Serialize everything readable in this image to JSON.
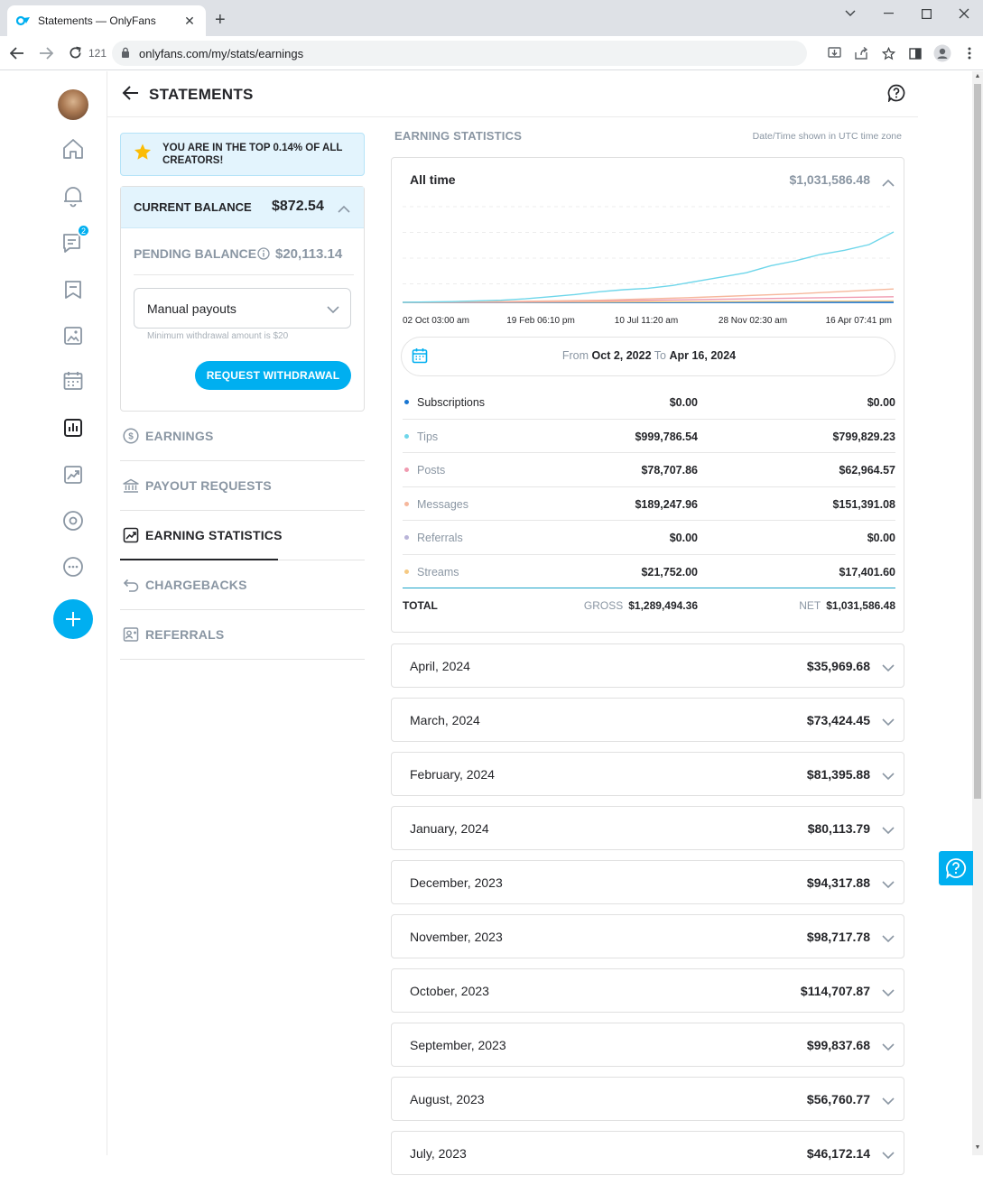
{
  "browser": {
    "tab_title": "Statements — OnlyFans",
    "url": "onlyfans.com/my/stats/earnings",
    "reload_count": "121"
  },
  "rail": {
    "messages_badge": "2"
  },
  "header": {
    "title": "STATEMENTS"
  },
  "banner": {
    "text": "YOU ARE IN THE TOP 0.14% OF ALL CREATORS!"
  },
  "balance": {
    "current_label": "CURRENT BALANCE",
    "current_value": "$872.54",
    "pending_label": "PENDING BALANCE",
    "pending_value": "$20,113.14",
    "payout_mode": "Manual payouts",
    "min_note": "Minimum withdrawal amount is $20",
    "withdraw_label": "REQUEST WITHDRAWAL"
  },
  "menu": [
    {
      "label": "EARNINGS",
      "icon": "dollar-circle-icon",
      "active": false
    },
    {
      "label": "PAYOUT REQUESTS",
      "icon": "bank-icon",
      "active": false
    },
    {
      "label": "EARNING STATISTICS",
      "icon": "chart-icon",
      "active": true
    },
    {
      "label": "CHARGEBACKS",
      "icon": "undo-icon",
      "active": false
    },
    {
      "label": "REFERRALS",
      "icon": "referral-icon",
      "active": false
    }
  ],
  "stats": {
    "title": "EARNING STATISTICS",
    "tz_note": "Date/Time shown in UTC time zone",
    "period_label": "All time",
    "period_total": "$1,031,586.48",
    "date_from_label": "From",
    "date_from": "Oct 2, 2022",
    "date_to_label": "To",
    "date_to": "Apr 16, 2024",
    "rows": [
      {
        "name": "Subscriptions",
        "gross": "$0.00",
        "net": "$0.00",
        "color": "#1976d2"
      },
      {
        "name": "Tips",
        "gross": "$999,786.54",
        "net": "$799,829.23",
        "color": "#6ed6ea"
      },
      {
        "name": "Posts",
        "gross": "$78,707.86",
        "net": "$62,964.57",
        "color": "#f09ab0"
      },
      {
        "name": "Messages",
        "gross": "$189,247.96",
        "net": "$151,391.08",
        "color": "#f6b79c"
      },
      {
        "name": "Referrals",
        "gross": "$0.00",
        "net": "$0.00",
        "color": "#b9b4d9"
      },
      {
        "name": "Streams",
        "gross": "$21,752.00",
        "net": "$17,401.60",
        "color": "#f5c982"
      }
    ],
    "total_label": "TOTAL",
    "gross_label": "GROSS",
    "gross_total": "$1,289,494.36",
    "net_label": "NET",
    "net_total": "$1,031,586.48"
  },
  "chart_data": {
    "type": "line",
    "x_tick_labels": [
      "02 Oct 03:00 am",
      "19 Feb 06:10 pm",
      "10 Jul 11:20 am",
      "28 Nov 02:30 am",
      "16 Apr 07:41 pm"
    ],
    "x_range": [
      "2022-10-02",
      "2024-04-16"
    ],
    "grid": true,
    "series": [
      {
        "name": "Tips",
        "color": "#6ed6ea",
        "x": [
          0,
          0.05,
          0.1,
          0.15,
          0.2,
          0.25,
          0.3,
          0.35,
          0.4,
          0.45,
          0.5,
          0.55,
          0.6,
          0.65,
          0.7,
          0.75,
          0.8,
          0.85,
          0.9,
          0.95,
          1.0
        ],
        "y": [
          0,
          0.005,
          0.01,
          0.02,
          0.03,
          0.05,
          0.08,
          0.11,
          0.15,
          0.18,
          0.2,
          0.24,
          0.3,
          0.36,
          0.42,
          0.52,
          0.59,
          0.68,
          0.74,
          0.82,
          1.0
        ]
      },
      {
        "name": "Messages",
        "color": "#f6b79c",
        "x": [
          0,
          0.2,
          0.4,
          0.6,
          0.8,
          1.0
        ],
        "y": [
          0,
          0.01,
          0.03,
          0.07,
          0.12,
          0.19
        ]
      },
      {
        "name": "Posts",
        "color": "#f09ab0",
        "x": [
          0,
          0.2,
          0.4,
          0.6,
          0.8,
          1.0
        ],
        "y": [
          0,
          0.005,
          0.02,
          0.04,
          0.06,
          0.08
        ]
      },
      {
        "name": "Streams",
        "color": "#f5c982",
        "x": [
          0,
          0.2,
          0.4,
          0.6,
          0.8,
          1.0
        ],
        "y": [
          0,
          0.002,
          0.006,
          0.01,
          0.015,
          0.02
        ]
      },
      {
        "name": "Subscriptions",
        "color": "#1976d2",
        "x": [
          0,
          1.0
        ],
        "y": [
          0,
          0
        ]
      }
    ]
  },
  "months": [
    {
      "label": "April, 2024",
      "amount": "$35,969.68"
    },
    {
      "label": "March, 2024",
      "amount": "$73,424.45"
    },
    {
      "label": "February, 2024",
      "amount": "$81,395.88"
    },
    {
      "label": "January, 2024",
      "amount": "$80,113.79"
    },
    {
      "label": "December, 2023",
      "amount": "$94,317.88"
    },
    {
      "label": "November, 2023",
      "amount": "$98,717.78"
    },
    {
      "label": "October, 2023",
      "amount": "$114,707.87"
    },
    {
      "label": "September, 2023",
      "amount": "$99,837.68"
    },
    {
      "label": "August, 2023",
      "amount": "$56,760.77"
    },
    {
      "label": "July, 2023",
      "amount": "$46,172.14"
    }
  ]
}
